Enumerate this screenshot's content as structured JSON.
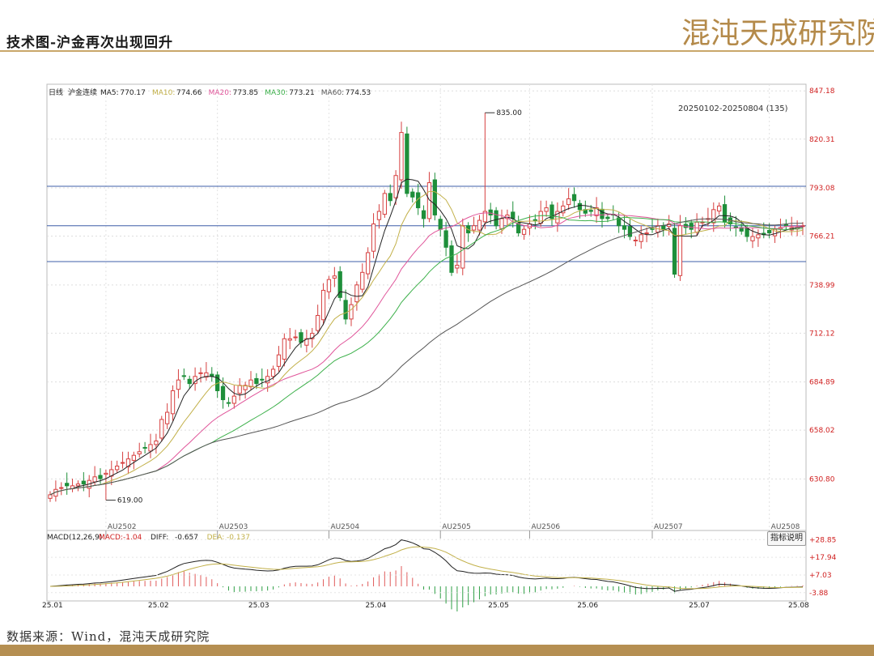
{
  "header": {
    "title": "技术图-沪金再次出现回升",
    "brand": "混沌天成研究院"
  },
  "source": "数据来源：Wind，混沌天成研究院",
  "chart_data": {
    "type": "candlestick",
    "main": {
      "legend": {
        "prefix": "日线",
        "name": "沪金连续",
        "items": [
          {
            "label": "MA5:",
            "value": "770.17",
            "color": "#222222"
          },
          {
            "label": "MA10:",
            "value": "774.66",
            "color": "#c2b049"
          },
          {
            "label": "MA20:",
            "value": "773.85",
            "color": "#e0559a"
          },
          {
            "label": "MA30:",
            "value": "773.21",
            "color": "#3cb04a"
          },
          {
            "label": "MA60:",
            "value": "774.53",
            "color": "#555555"
          }
        ]
      },
      "period": "20250102-20250804 (135)",
      "ylim": [
        603,
        850
      ],
      "y_ticks": [
        "847.18",
        "820.31",
        "793.08",
        "766.21",
        "738.99",
        "712.12",
        "684.89",
        "658.02",
        "630.80"
      ],
      "h_lines": [
        794,
        772,
        752
      ],
      "annotations": [
        {
          "text": "835.00",
          "index": 78,
          "value": 835
        },
        {
          "text": "619.00",
          "index": 10,
          "value": 619
        }
      ],
      "contracts": [
        "AU2502",
        "AU2503",
        "AU2504",
        "AU2505",
        "AU2506",
        "AU2507",
        "AU2508"
      ],
      "contract_index": [
        10,
        30,
        50,
        70,
        86,
        108,
        129
      ],
      "x_labels": [
        "25.01",
        "25.02",
        "25.03",
        "25.04",
        "25.05",
        "25.06",
        "25.07",
        "25.08"
      ],
      "x_label_index": [
        0,
        19,
        37,
        58,
        80,
        96,
        116,
        136
      ],
      "closes": [
        622,
        625,
        626,
        627,
        627,
        628,
        628,
        630,
        632,
        631,
        634,
        636,
        638,
        640,
        642,
        644,
        646,
        648,
        650,
        652,
        664,
        668,
        680,
        686,
        688,
        684,
        688,
        690,
        690,
        688,
        680,
        675,
        673,
        677,
        683,
        683,
        686,
        684,
        686,
        688,
        692,
        700,
        709,
        709,
        710,
        707,
        709,
        712,
        722,
        736,
        742,
        744,
        732,
        720,
        728,
        739,
        746,
        757,
        773,
        780,
        790,
        786,
        800,
        824,
        790,
        788,
        782,
        776,
        796,
        778,
        770,
        760,
        746,
        750,
        772,
        768,
        772,
        775,
        780,
        778,
        772,
        776,
        778,
        776,
        768,
        770,
        773,
        775,
        780,
        782,
        776,
        780,
        783,
        787,
        786,
        781,
        779,
        780,
        782,
        776,
        776,
        778,
        772,
        770,
        766,
        764,
        767,
        768,
        770,
        772,
        770,
        773,
        745,
        772,
        771,
        770,
        774,
        774,
        776,
        781,
        783,
        774,
        773,
        771,
        769,
        766,
        766,
        767,
        767,
        768,
        770,
        771,
        772,
        771,
        771,
        772
      ]
    },
    "macd": {
      "label": "MACD(12,26,9)",
      "items": [
        {
          "label": "MACD:",
          "value": "-1.04",
          "color": "#d02020"
        },
        {
          "label": "DIFF:",
          "value": "-0.657",
          "color": "#222222"
        },
        {
          "label": "DEA:",
          "value": "-0.137",
          "color": "#c2b049"
        }
      ],
      "ylim": [
        -7,
        32
      ],
      "y_ticks": [
        "+28.85",
        "+17.94",
        "+7.03",
        "-3.88"
      ]
    },
    "help_button": "指标说明"
  }
}
